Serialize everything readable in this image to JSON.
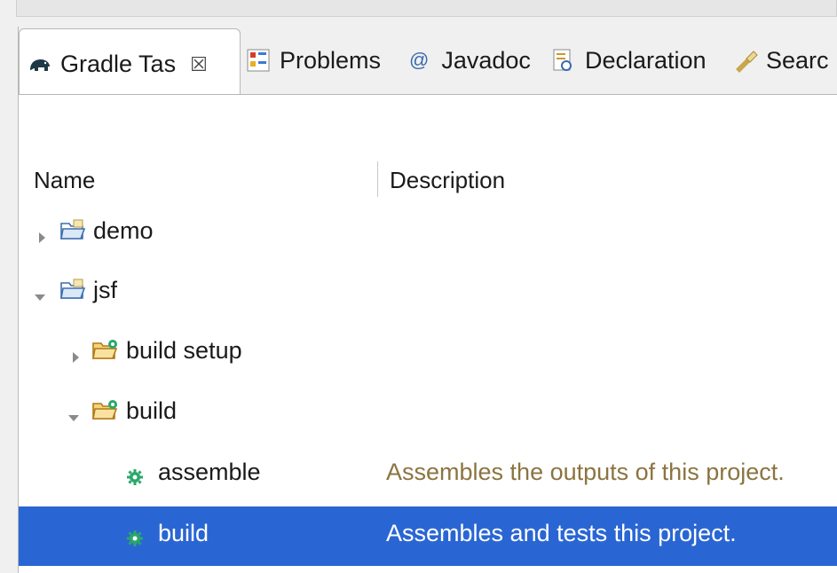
{
  "tabs": [
    {
      "label": "Gradle Tas",
      "icon": "gradle-elephant-icon",
      "active": true,
      "close": "☒"
    },
    {
      "label": "Problems",
      "icon": "problems-icon"
    },
    {
      "label": "Javadoc",
      "icon": "at-sign-icon"
    },
    {
      "label": "Declaration",
      "icon": "declaration-icon"
    },
    {
      "label": "Searc",
      "icon": "search-torch-icon"
    }
  ],
  "columns": {
    "name": "Name",
    "description": "Description"
  },
  "tree": [
    {
      "label": "demo",
      "description": "",
      "expanded": false,
      "icon": "project-folder-icon"
    },
    {
      "label": "jsf",
      "description": "",
      "expanded": true,
      "icon": "project-folder-icon"
    },
    {
      "label": "build setup",
      "description": "",
      "expanded": false,
      "icon": "task-group-folder-icon"
    },
    {
      "label": "build",
      "description": "",
      "expanded": true,
      "icon": "task-group-folder-icon"
    },
    {
      "label": "assemble",
      "description": "Assembles the outputs of this project.",
      "icon": "task-gear-icon"
    },
    {
      "label": "build",
      "description": "Assembles and tests this project.",
      "icon": "task-gear-icon",
      "selected": true
    }
  ],
  "colors": {
    "selection": "#2a66d3",
    "description_text": "#8b7440",
    "gear": "#2aa86a"
  }
}
